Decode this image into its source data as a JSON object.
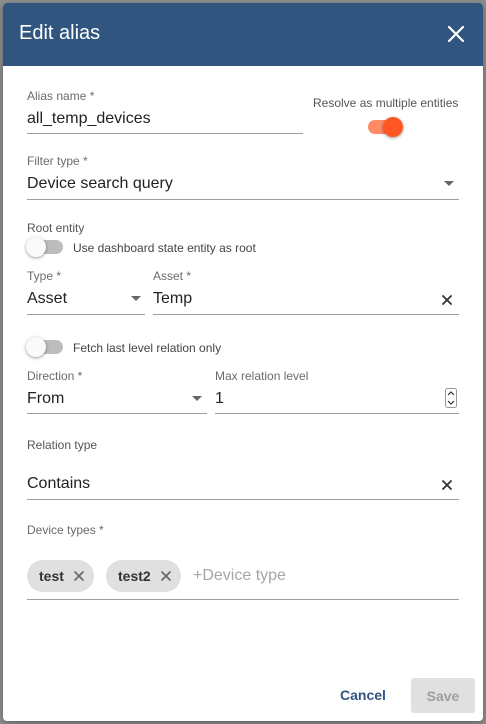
{
  "dialog": {
    "title": "Edit alias",
    "alias_name": {
      "label": "Alias name *",
      "value": "all_temp_devices"
    },
    "resolve_multiple": {
      "label": "Resolve as multiple entities",
      "checked": true
    },
    "filter_type": {
      "label": "Filter type *",
      "value": "Device search query"
    },
    "root_entity": {
      "label": "Root entity",
      "use_dashboard_state": {
        "label": "Use dashboard state entity as root",
        "checked": false
      }
    },
    "type": {
      "label": "Type *",
      "value": "Asset"
    },
    "asset": {
      "label": "Asset *",
      "value": "Temp"
    },
    "fetch_last_level": {
      "label": "Fetch last level relation only",
      "checked": false
    },
    "direction": {
      "label": "Direction *",
      "value": "From"
    },
    "max_relation_level": {
      "label": "Max relation level",
      "value": "1"
    },
    "relation_type": {
      "label": "Relation type",
      "value": "Contains"
    },
    "device_types": {
      "label": "Device types *",
      "chips": [
        "test",
        "test2"
      ],
      "placeholder": "+Device type"
    },
    "buttons": {
      "cancel": "Cancel",
      "save": "Save"
    }
  },
  "colors": {
    "header": "#305680",
    "accent": "#ff5722",
    "accent_track": "#ff8a65",
    "primary_text": "#305680",
    "disabled_button": "#e0e0e0",
    "disabled_text": "#9e9e9e"
  },
  "icons": {
    "close": "close-icon",
    "dropdown": "chevron-down-icon",
    "clear": "clear-icon",
    "chip_remove": "chip-remove-icon",
    "spinner": "number-spinner-icon"
  }
}
